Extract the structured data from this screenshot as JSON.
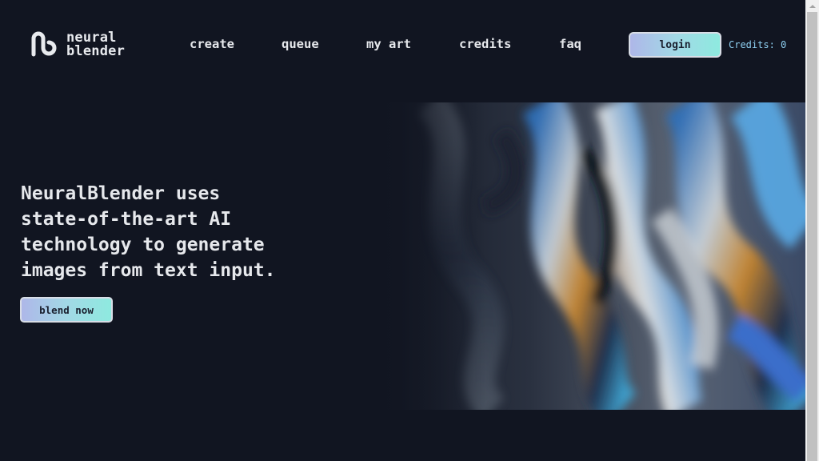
{
  "header": {
    "logo_icon": "swirl-n-logo-icon",
    "logo_line1": "neural",
    "logo_line2": "blender",
    "nav": [
      {
        "label": "create"
      },
      {
        "label": "queue"
      },
      {
        "label": "my art"
      },
      {
        "label": "credits"
      },
      {
        "label": "faq"
      }
    ],
    "login_label": "login",
    "credits_text": "Credits: 0"
  },
  "hero": {
    "line1": "NeuralBlender uses",
    "line2": "state-of-the-art AI",
    "line3": "technology to generate",
    "line4": "images from text input.",
    "cta_label": "blend now",
    "image_alt": "abstract iridescent liquid swirl artwork"
  },
  "colors": {
    "background": "#111521",
    "text": "#e6e8ec",
    "accent_gradient_start": "#aeb7e8",
    "accent_gradient_end": "#8eeadf",
    "credits_text": "#8fd0f2"
  }
}
